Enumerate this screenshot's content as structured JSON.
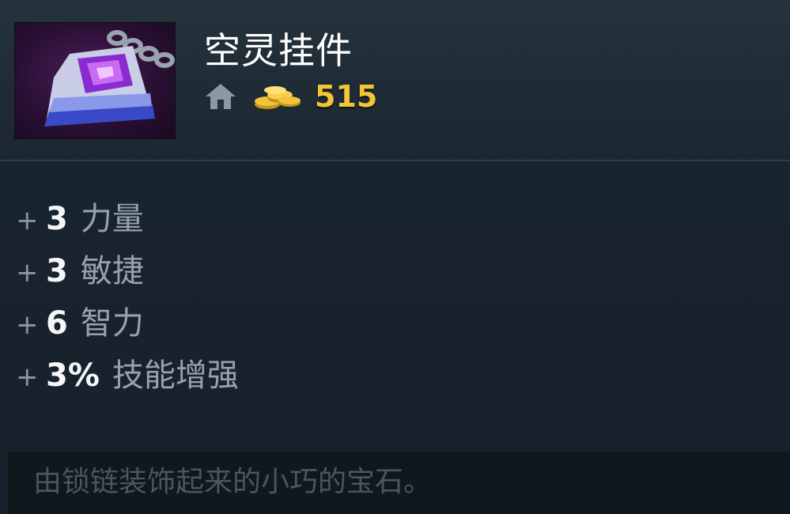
{
  "item": {
    "name": "空灵挂件",
    "cost": "515",
    "icons": {
      "item_image": "ethereal-pendant-icon",
      "shop_location": "home-icon",
      "currency": "gold-coins-icon"
    }
  },
  "attributes": [
    {
      "plus": "+",
      "value": "3",
      "label": "力量"
    },
    {
      "plus": "+",
      "value": "3",
      "label": "敏捷"
    },
    {
      "plus": "+",
      "value": "6",
      "label": "智力"
    },
    {
      "plus": "+",
      "value": "3%",
      "label": "技能增强"
    }
  ],
  "lore": "由锁链装饰起来的小巧的宝石。",
  "colors": {
    "gold": "#f2c533",
    "attribute_value": "#f4f6f7",
    "attribute_label": "#97a2ab",
    "lore_text": "#4a5660",
    "header_bg": "#25333d",
    "body_bg": "#16202a"
  }
}
